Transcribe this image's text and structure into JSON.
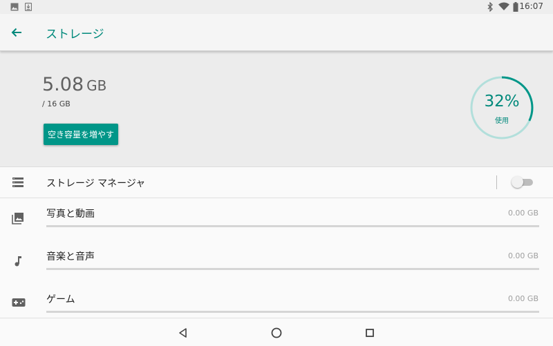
{
  "status_bar": {
    "time": "16:07",
    "icons": [
      "image-icon",
      "download-icon",
      "bluetooth-icon",
      "wifi-icon",
      "battery-icon"
    ]
  },
  "app_bar": {
    "title": "ストレージ",
    "back_icon": "arrow-back-icon"
  },
  "summary": {
    "used_value": "5.08",
    "used_unit": "GB",
    "total": "/ 16 GB",
    "free_up_button": "空き容量を増やす",
    "percent_label": "32%",
    "percent_used": 32,
    "used_caption": "使用"
  },
  "storage_manager": {
    "label": "ストレージ マネージャ",
    "icon": "storage-list-icon",
    "enabled": false
  },
  "categories": [
    {
      "label": "写真と動画",
      "size": "0.00 GB",
      "icon": "photo-library-icon",
      "fraction": 0
    },
    {
      "label": "音楽と音声",
      "size": "0.00 GB",
      "icon": "music-note-icon",
      "fraction": 0
    },
    {
      "label": "ゲーム",
      "size": "0.00 GB",
      "icon": "gamepad-icon",
      "fraction": 0
    }
  ],
  "nav_bar": {
    "buttons": [
      "back-triangle-icon",
      "home-circle-icon",
      "recents-square-icon"
    ]
  },
  "colors": {
    "accent": "#009688",
    "accent_text": "#00897b",
    "ring_track": "#b2dfdb"
  }
}
